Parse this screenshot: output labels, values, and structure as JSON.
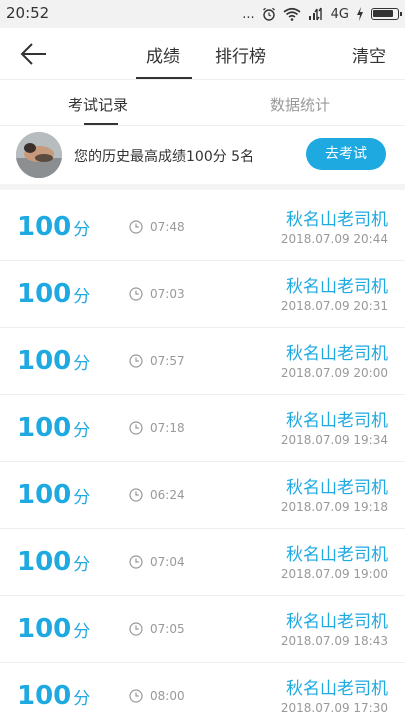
{
  "status_bar": {
    "time": "20:52",
    "dots": "...",
    "network": "4G",
    "battery_level": 0.85
  },
  "header": {
    "tabs": [
      {
        "label": "成绩",
        "active": true
      },
      {
        "label": "排行榜",
        "active": false
      }
    ],
    "clear_label": "清空",
    "back_icon": "arrow-left-icon"
  },
  "subtabs": [
    {
      "label": "考试记录",
      "active": true
    },
    {
      "label": "数据统计",
      "active": false
    }
  ],
  "best": {
    "text": "您的历史最高成绩100分  5名",
    "button_label": "去考试"
  },
  "records": [
    {
      "score": "100",
      "unit": "分",
      "duration": "07:48",
      "name": "秋名山老司机",
      "date": "2018.07.09  20:44"
    },
    {
      "score": "100",
      "unit": "分",
      "duration": "07:03",
      "name": "秋名山老司机",
      "date": "2018.07.09  20:31"
    },
    {
      "score": "100",
      "unit": "分",
      "duration": "07:57",
      "name": "秋名山老司机",
      "date": "2018.07.09  20:00"
    },
    {
      "score": "100",
      "unit": "分",
      "duration": "07:18",
      "name": "秋名山老司机",
      "date": "2018.07.09  19:34"
    },
    {
      "score": "100",
      "unit": "分",
      "duration": "06:24",
      "name": "秋名山老司机",
      "date": "2018.07.09  19:18"
    },
    {
      "score": "100",
      "unit": "分",
      "duration": "07:04",
      "name": "秋名山老司机",
      "date": "2018.07.09  19:00"
    },
    {
      "score": "100",
      "unit": "分",
      "duration": "07:05",
      "name": "秋名山老司机",
      "date": "2018.07.09  18:43"
    },
    {
      "score": "100",
      "unit": "分",
      "duration": "08:00",
      "name": "秋名山老司机",
      "date": "2018.07.09  17:30"
    }
  ],
  "colors": {
    "accent": "#1fa9e1",
    "muted_text": "#999999",
    "divider": "#eeeeee"
  }
}
